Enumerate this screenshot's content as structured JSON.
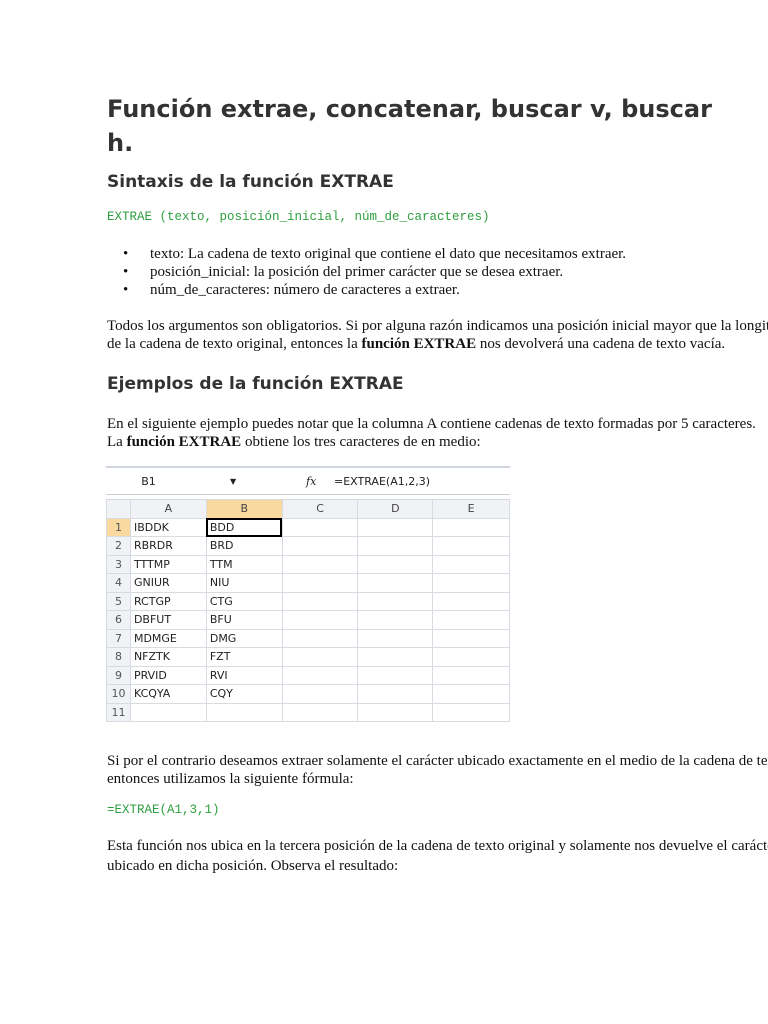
{
  "title_line1": "Función extrae, concatenar, buscar v, buscar",
  "title_line2": "h.",
  "section1": {
    "heading": "Sintaxis de la función EXTRAE",
    "syntax": "EXTRAE (texto, posición_inicial, núm_de_caracteres)",
    "bullets": [
      "texto: La cadena de texto original que contiene el dato que necesitamos extraer.",
      "posición_inicial: la posición del primer carácter que se desea extraer.",
      "núm_de_caracteres: número de caracteres a extraer."
    ],
    "para_line1": "Todos los argumentos son obligatorios. Si por alguna razón indicamos una posición inicial mayor que la longitud",
    "para_line2_a": "de la cadena de texto original, entonces la ",
    "para_line2_bold": "función EXTRAE",
    "para_line2_b": " nos devolverá una cadena de texto vacía."
  },
  "section2": {
    "heading": "Ejemplos de la función EXTRAE",
    "para_line1": "En el siguiente ejemplo puedes notar que la columna A contiene cadenas de texto formadas por 5 caracteres.",
    "para_line2_a": "La ",
    "para_line2_bold": "función EXTRAE",
    "para_line2_b": " obtiene los tres caracteres de en medio:",
    "para2_line1": "Si por el contrario deseamos extraer solamente el carácter ubicado exactamente en el medio de la cadena de texto,",
    "para2_line2": "entonces utilizamos la siguiente fórmula:",
    "formula": "=EXTRAE(A1,3,1)",
    "para3_line1": "Esta función nos ubica en la tercera posición de la cadena de texto original y solamente nos devuelve el carácter",
    "para3_line2": "ubicado en dicha posición. Observa el resultado:"
  },
  "sheet": {
    "name_box": "B1",
    "fx": "fx",
    "formula": "=EXTRAE(A1,2,3)",
    "columns": [
      "A",
      "B",
      "C",
      "D",
      "E"
    ],
    "rows": [
      {
        "n": "1",
        "a": "IBDDK",
        "b": "BDD"
      },
      {
        "n": "2",
        "a": "RBRDR",
        "b": "BRD"
      },
      {
        "n": "3",
        "a": "TTTMP",
        "b": "TTM"
      },
      {
        "n": "4",
        "a": "GNIUR",
        "b": "NIU"
      },
      {
        "n": "5",
        "a": "RCTGP",
        "b": "CTG"
      },
      {
        "n": "6",
        "a": "DBFUT",
        "b": "BFU"
      },
      {
        "n": "7",
        "a": "MDMGE",
        "b": "DMG"
      },
      {
        "n": "8",
        "a": "NFZTK",
        "b": "FZT"
      },
      {
        "n": "9",
        "a": "PRVID",
        "b": "RVI"
      },
      {
        "n": "10",
        "a": "KCQYA",
        "b": "CQY"
      },
      {
        "n": "11",
        "a": "",
        "b": ""
      }
    ]
  }
}
